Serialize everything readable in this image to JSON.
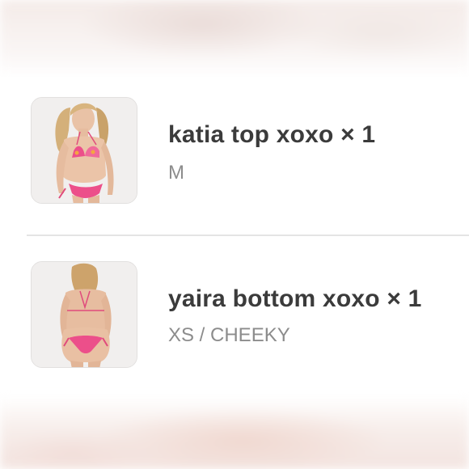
{
  "order_items": [
    {
      "name": "katia top xoxo",
      "quantity_label": "× 1",
      "variant": "M",
      "thumbnail_icon": "product-photo-front-view"
    },
    {
      "name": "yaira bottom xoxo",
      "quantity_label": "× 1",
      "variant": "XS / CHEEKY",
      "thumbnail_icon": "product-photo-back-view"
    }
  ],
  "colors": {
    "title_text": "#3b3b3b",
    "variant_text": "#8c8c8c",
    "divider": "#e4e4e4",
    "thumbnail_bg": "#f1efee",
    "swimwear_pink": "#ec4f8a"
  }
}
